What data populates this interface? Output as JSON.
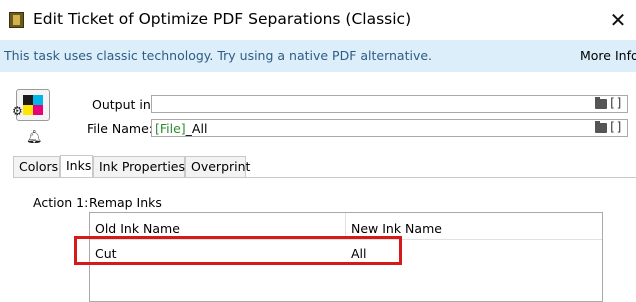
{
  "window": {
    "title": "Edit Ticket of Optimize PDF Separations (Classic)"
  },
  "infobar": {
    "message": "This task uses classic technology. Try using a native PDF alternative.",
    "more_info": "More Info"
  },
  "fields": {
    "output_in": {
      "label": "Output in:",
      "value": ""
    },
    "file_name": {
      "label": "File Name:",
      "token": "[File]",
      "suffix": "_All"
    }
  },
  "tabs": [
    {
      "label": "Colors",
      "active": false
    },
    {
      "label": "Inks",
      "active": true
    },
    {
      "label": "Ink Properties",
      "active": false
    },
    {
      "label": "Overprint",
      "active": false
    }
  ],
  "action": {
    "label": "Action 1:",
    "value": "Remap Inks"
  },
  "table": {
    "columns": [
      "Old Ink Name",
      "New Ink Name"
    ],
    "rows": [
      {
        "old": "Cut",
        "new": "All"
      }
    ]
  },
  "colors": {
    "infobar_bg": "#dbeef9",
    "infobar_text": "#2f5c86",
    "token_green": "#2e8b2e",
    "highlight_red": "#d61a1a"
  },
  "icons": {
    "ticket": "cmyk-ticket-icon",
    "gear": "gear-icon",
    "bell": "bell-icon",
    "folder": "folder-icon",
    "bracket": "variable-bracket-icon",
    "close": "close-icon"
  }
}
